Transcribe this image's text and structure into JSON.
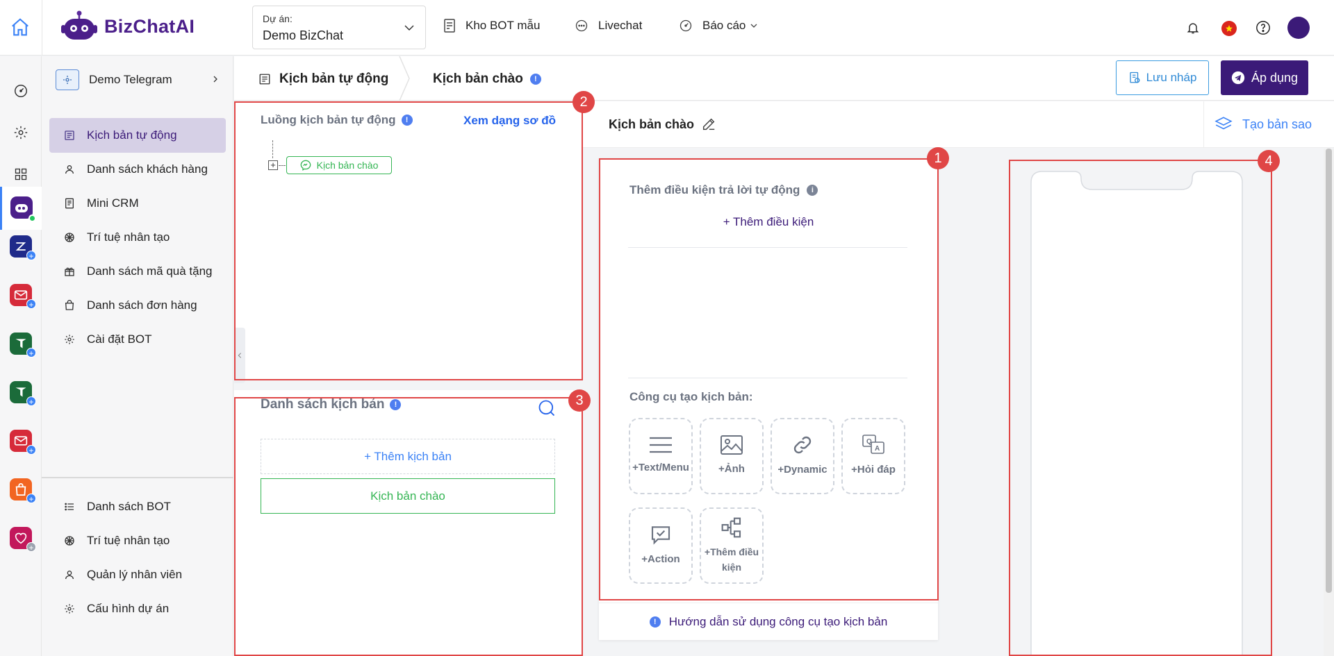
{
  "header": {
    "logo_text": "BizChatAI",
    "project_label": "Dự án:",
    "project_value": "Demo BizChat",
    "nav": [
      {
        "label": "Kho BOT mẫu"
      },
      {
        "label": "Livechat"
      },
      {
        "label": "Báo cáo"
      }
    ]
  },
  "sidebar": {
    "bot_name": "Demo Telegram",
    "items": [
      {
        "label": "Kịch bản tự động",
        "active": true
      },
      {
        "label": "Danh sách khách hàng"
      },
      {
        "label": "Mini CRM"
      },
      {
        "label": "Trí tuệ nhân tạo"
      },
      {
        "label": "Danh sách mã quà tặng"
      },
      {
        "label": "Danh sách đơn hàng"
      },
      {
        "label": "Cài đặt BOT"
      }
    ],
    "bottom_items": [
      {
        "label": "Danh sách BOT"
      },
      {
        "label": "Trí tuệ nhân tạo"
      },
      {
        "label": "Quản lý nhân viên"
      },
      {
        "label": "Cấu hình dự án"
      }
    ]
  },
  "subheader": {
    "crumb1": "Kịch bản tự động",
    "crumb2": "Kịch bản chào",
    "save_draft": "Lưu nháp",
    "apply": "Áp dụng"
  },
  "flow_panel": {
    "title": "Luồng kịch bản tự động",
    "view_diagram": "Xem dạng sơ đồ",
    "node_label": "Kịch bản chào"
  },
  "script_list": {
    "title": "Danh sách kịch bản",
    "add_label": "+ Thêm kịch bản",
    "items": [
      "Kịch bản chào"
    ]
  },
  "editor": {
    "title": "Kịch bản chào",
    "copy_label": "Tạo bản sao",
    "condition_title": "Thêm điều kiện trả lời tự động",
    "add_condition": "+ Thêm điều kiện",
    "tools_title": "Công cụ tạo kịch bản:",
    "tools": [
      {
        "label": "+Text/Menu",
        "icon": "menu-lines-icon"
      },
      {
        "label": "+Ảnh",
        "icon": "image-icon"
      },
      {
        "label": "+Dynamic",
        "icon": "link-icon"
      },
      {
        "label": "+Hỏi đáp",
        "icon": "qa-icon"
      },
      {
        "label": "+Action",
        "icon": "action-check-icon"
      },
      {
        "label": "+Thêm điều kiện",
        "icon": "condition-tree-icon"
      }
    ],
    "guide": "Hướng dẫn sử dụng công cụ tạo kịch bản"
  },
  "annotations": [
    "1",
    "2",
    "3",
    "4"
  ],
  "colors": {
    "brand": "#3b1a78",
    "link": "#2563eb",
    "green": "#22c55e",
    "annotation_red": "#e04646",
    "active_nav_bg": "#d6d0e6"
  }
}
